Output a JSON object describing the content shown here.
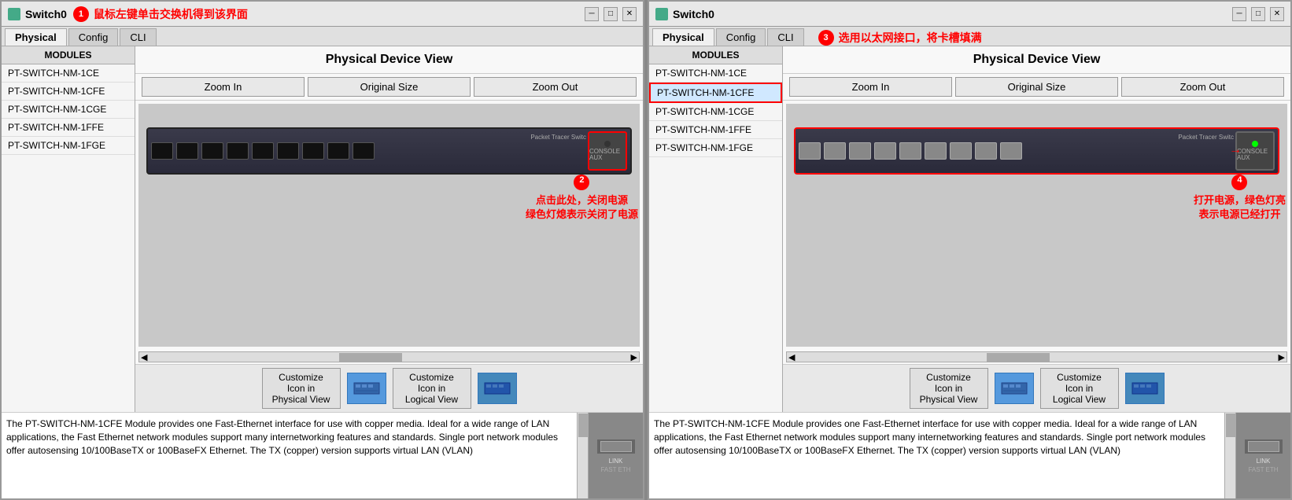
{
  "leftWindow": {
    "title": "Switch0",
    "annotation1": "鼠标左键单击交换机得到该界面",
    "tabs": [
      "Physical",
      "Config",
      "CLI"
    ],
    "activeTab": "Physical",
    "modulesHeader": "MODULES",
    "modules": [
      "PT-SWITCH-NM-1CE",
      "PT-SWITCH-NM-1CFE",
      "PT-SWITCH-NM-1CGE",
      "PT-SWITCH-NM-1FFE",
      "PT-SWITCH-NM-1FGE"
    ],
    "deviceViewTitle": "Physical Device View",
    "zoomIn": "Zoom In",
    "originalSize": "Original Size",
    "zoomOut": "Zoom Out",
    "annotation2_line1": "点击此处，关闭电源",
    "annotation2_line2": "绿色灯熄表示关闭了电源",
    "customizePhysical": "Customize\nIcon in\nPhysical View",
    "customizeLogical": "Customize\nIcon in\nLogical View",
    "description": "The PT-SWITCH-NM-1CFE Module provides one Fast-Ethernet interface for use with copper media. Ideal for a wide range of LAN applications, the Fast Ethernet network modules support many internetworking features and standards. Single port network modules offer autosensing 10/100BaseTX or 100BaseFX Ethernet. The TX (copper) version supports virtual LAN (VLAN)"
  },
  "rightWindow": {
    "title": "Switch0",
    "annotation3": "选用以太网接口，将卡槽填满",
    "annotation4_line1": "打开电源，绿色灯亮",
    "annotation4_line2": "表示电源已经打开",
    "tabs": [
      "Physical",
      "Config",
      "CLI"
    ],
    "activeTab": "Physical",
    "modulesHeader": "MODULES",
    "modules": [
      "PT-SWITCH-NM-1CE",
      "PT-SWITCH-NM-1CFE",
      "PT-SWITCH-NM-1CGE",
      "PT-SWITCH-NM-1FFE",
      "PT-SWITCH-NM-1FGE"
    ],
    "selectedModule": "PT-SWITCH-NM-1CFE",
    "deviceViewTitle": "Physical Device View",
    "zoomIn": "Zoom In",
    "originalSize": "Original Size",
    "zoomOut": "Zoom Out",
    "customizePhysical": "Customize\nIcon in\nPhysical View",
    "customizeLogical": "Customize\nIcon in\nLogical View",
    "description": "The PT-SWITCH-NM-1CFE Module provides one Fast-Ethernet interface for use with copper media. Ideal for a wide range of LAN applications, the Fast Ethernet network modules support many internetworking features and standards. Single port network modules offer autosensing 10/100BaseTX or 100BaseFX Ethernet. The TX (copper) version supports virtual LAN (VLAN)"
  }
}
